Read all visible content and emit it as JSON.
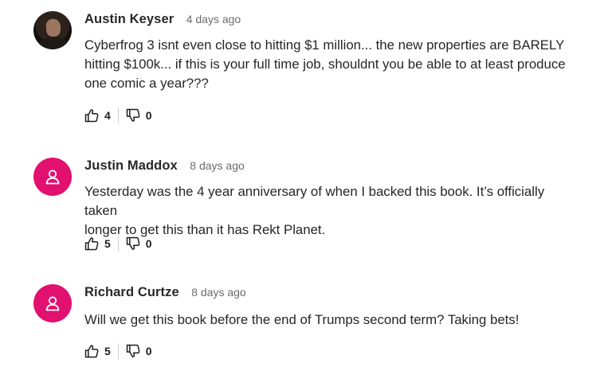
{
  "comments": [
    {
      "author": "Austin Keyser",
      "time": "4 days ago",
      "text_lines": [
        "Cyberfrog 3 isnt even close to hitting $1 million... the new properties are BARELY",
        "hitting $100k... if this is your full time job, shouldnt you be able to at least produce",
        "one comic a year???"
      ],
      "upvotes": "4",
      "downvotes": "0",
      "avatar": "photo"
    },
    {
      "author": "Justin Maddox",
      "time": "8 days ago",
      "text_lines": [
        "Yesterday was the 4 year anniversary of when I backed this book. It’s officially taken",
        "longer to get this than it has Rekt Planet."
      ],
      "upvotes": "5",
      "downvotes": "0",
      "avatar": "user-icon"
    },
    {
      "author": "Richard Curtze",
      "time": "8 days ago",
      "text_lines": [
        "Will we get this book before the end of Trumps second term? Taking bets!"
      ],
      "upvotes": "5",
      "downvotes": "0",
      "avatar": "user-icon"
    }
  ],
  "colors": {
    "default_avatar": "#e2106e",
    "author": "#282828",
    "timestamp": "#6b6b6b",
    "body": "#262626"
  },
  "icons": {
    "upvote": "thumbs-up-icon",
    "downvote": "thumbs-down-icon",
    "default_avatar": "user-icon"
  }
}
